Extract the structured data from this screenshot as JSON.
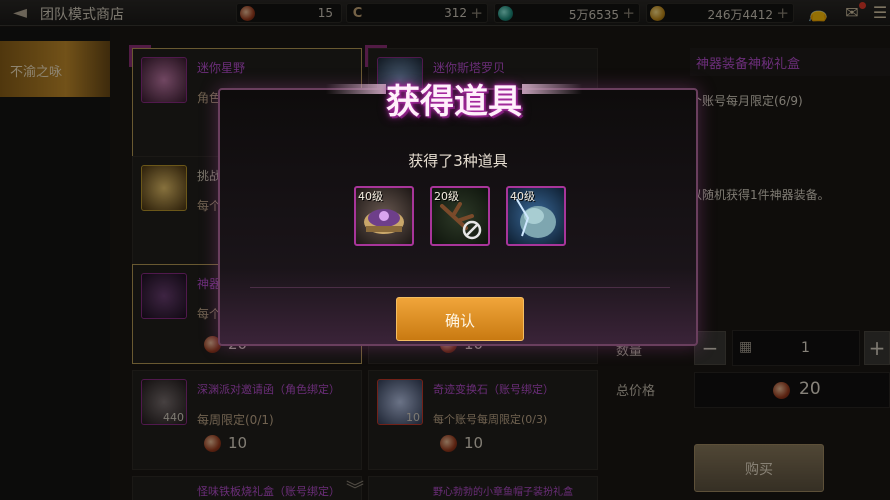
{
  "topbar": {
    "title": "团队模式商店",
    "currencies": [
      {
        "icon": "orb-currency-icon",
        "value": "15"
      },
      {
        "icon": "c-currency-icon",
        "value": "312"
      },
      {
        "icon": "gem-currency-icon",
        "value": "5万6535"
      },
      {
        "icon": "gold-coin-icon",
        "value": "246万4412"
      }
    ],
    "plus": "+"
  },
  "sidebar": {
    "tabs": [
      {
        "label": "不渝之咏",
        "active": true
      }
    ]
  },
  "items": [
    {
      "name": "迷你星野",
      "limit": "角色",
      "price": "",
      "qty": ""
    },
    {
      "name": "迷你斯塔罗贝",
      "limit": "",
      "price": "",
      "qty": ""
    },
    {
      "name": "挑战",
      "limit": "每个",
      "price": "",
      "qty": ""
    },
    {
      "name": "",
      "limit": "",
      "price": "",
      "qty": ""
    },
    {
      "name": "神器",
      "limit": "每个",
      "price": "20",
      "qty": ""
    },
    {
      "name": "",
      "limit": "",
      "price": "10",
      "qty": ""
    },
    {
      "name": "深渊派对邀请函（角色绑定）",
      "limit": "每周限定(0/1)",
      "price": "10",
      "qty": "440"
    },
    {
      "name": "奇迹变换石（账号绑定）",
      "limit": "每个账号每周限定(0/3)",
      "price": "10",
      "qty": "10"
    },
    {
      "name": "怪味铁板烧礼盒（账号绑定）",
      "limit": "",
      "price": "",
      "qty": ""
    },
    {
      "name": "野心勃勃的小章鱼帽子装扮礼盒",
      "limit": "",
      "price": "",
      "qty": ""
    }
  ],
  "detail": {
    "title": "神器装备神秘礼盒",
    "limit": "个账号每月限定(6/9)",
    "desc": "以随机获得1件神器装备。",
    "qty_label": "数量",
    "qty": "1",
    "minus": "−",
    "plus": "+",
    "total_label": "总价格",
    "total": "20",
    "buy": "购买"
  },
  "modal": {
    "title": "获得道具",
    "subtitle": "获得了3种道具",
    "rewards": [
      {
        "level": "40级",
        "icon": "crown-item-icon"
      },
      {
        "level": "20级",
        "icon": "branch-item-icon"
      },
      {
        "level": "40级",
        "icon": "beast-item-icon"
      }
    ],
    "confirm": "确认"
  }
}
